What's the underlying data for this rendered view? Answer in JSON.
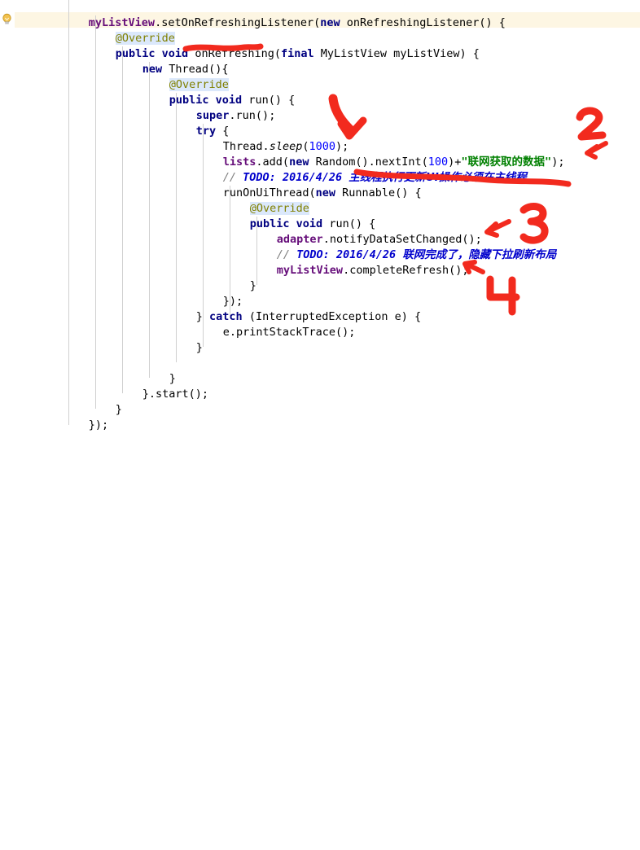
{
  "editor": {
    "app": "code-editor",
    "language": "Java",
    "font_size_px": 13.5,
    "line_height_px": 19,
    "background": "#ffffff",
    "caret_line_background": "#fdf6e3",
    "annotation_background": "#dbe8fb",
    "indent_guide_color": "#d0d0d0",
    "colors": {
      "keyword": "#000080",
      "field": "#660e7a",
      "number": "#0000ff",
      "string": "#008000",
      "comment": "#808080",
      "todo": "#0000cc",
      "annotation": "#808000",
      "plain": "#000000",
      "marker_red": "#f22a1e"
    },
    "gutter": {
      "icon": "lightbulb-icon",
      "icon_row": 1
    }
  },
  "code_lines": [
    {
      "id": 0,
      "indent": 4,
      "text": "myListView.setOnRefreshingListener(new onRefreshingListener() {"
    },
    {
      "id": 1,
      "indent": 6,
      "text": "@Override"
    },
    {
      "id": 2,
      "indent": 6,
      "text": "public void onRefreshing(final MyListView myListView) {"
    },
    {
      "id": 3,
      "indent": 8,
      "text": "new Thread(){"
    },
    {
      "id": 4,
      "indent": 10,
      "text": "@Override"
    },
    {
      "id": 5,
      "indent": 10,
      "text": "public void run() {"
    },
    {
      "id": 6,
      "indent": 12,
      "text": "super.run();"
    },
    {
      "id": 7,
      "indent": 12,
      "text": "try {"
    },
    {
      "id": 8,
      "indent": 14,
      "text": "Thread.sleep(1000);"
    },
    {
      "id": 9,
      "indent": 14,
      "text": "lists.add(new Random().nextInt(100)+\"联网获取的数据\");"
    },
    {
      "id": 10,
      "indent": 14,
      "text": "// TODO: 2016/4/26 主线程执行更新UI操作必须在主线程"
    },
    {
      "id": 11,
      "indent": 14,
      "text": "runOnUiThread(new Runnable() {"
    },
    {
      "id": 12,
      "indent": 16,
      "text": "@Override"
    },
    {
      "id": 13,
      "indent": 16,
      "text": "public void run() {"
    },
    {
      "id": 14,
      "indent": 18,
      "text": "adapter.notifyDataSetChanged();"
    },
    {
      "id": 15,
      "indent": 18,
      "text": "// TODO: 2016/4/26 联网完成了，隐藏下拉刷新布局"
    },
    {
      "id": 16,
      "indent": 18,
      "text": "myListView.completeRefresh();"
    },
    {
      "id": 17,
      "indent": 16,
      "text": "}"
    },
    {
      "id": 18,
      "indent": 14,
      "text": "});"
    },
    {
      "id": 19,
      "indent": 12,
      "text": "} catch (InterruptedException e) {"
    },
    {
      "id": 20,
      "indent": 14,
      "text": "e.printStackTrace();"
    },
    {
      "id": 21,
      "indent": 12,
      "text": "}"
    },
    {
      "id": 22,
      "indent": 10,
      "text": "}"
    },
    {
      "id": 23,
      "indent": 8,
      "text": "}.start();"
    },
    {
      "id": 24,
      "indent": 6,
      "text": "}"
    },
    {
      "id": 25,
      "indent": 4,
      "text": "});"
    }
  ],
  "strings": {
    "network_data": "联网获取的数据",
    "todo_label": "// TODO: 2016/4/26",
    "todo_1_text": "主线程执行更新UI操作必须在主线程",
    "todo_2_text": "联网完成了，隐藏下拉刷新布局"
  },
  "annotations": {
    "color": "#f22a1e",
    "marks": [
      {
        "id": "underline-onrefreshing",
        "kind": "underline",
        "target": "onRefreshing("
      },
      {
        "id": "arrow-1",
        "kind": "arrow-with-number",
        "label": "1",
        "target": "Thread.sleep(1000);"
      },
      {
        "id": "number-2",
        "kind": "arrow-with-number",
        "label": "2",
        "target": "lists.add(... \"联网获取的数据\");"
      },
      {
        "id": "underline-todo-1",
        "kind": "underline",
        "target": "主线程执行更新UI操作必须在主线程"
      },
      {
        "id": "number-3",
        "kind": "arrow-with-number",
        "label": "3",
        "target": "adapter.notifyDataSetChanged();"
      },
      {
        "id": "number-4",
        "kind": "arrow-with-number",
        "label": "4",
        "target": "myListView.completeRefresh();"
      }
    ],
    "labels": {
      "one": "1",
      "two": "2",
      "three": "3",
      "four": "4"
    }
  }
}
